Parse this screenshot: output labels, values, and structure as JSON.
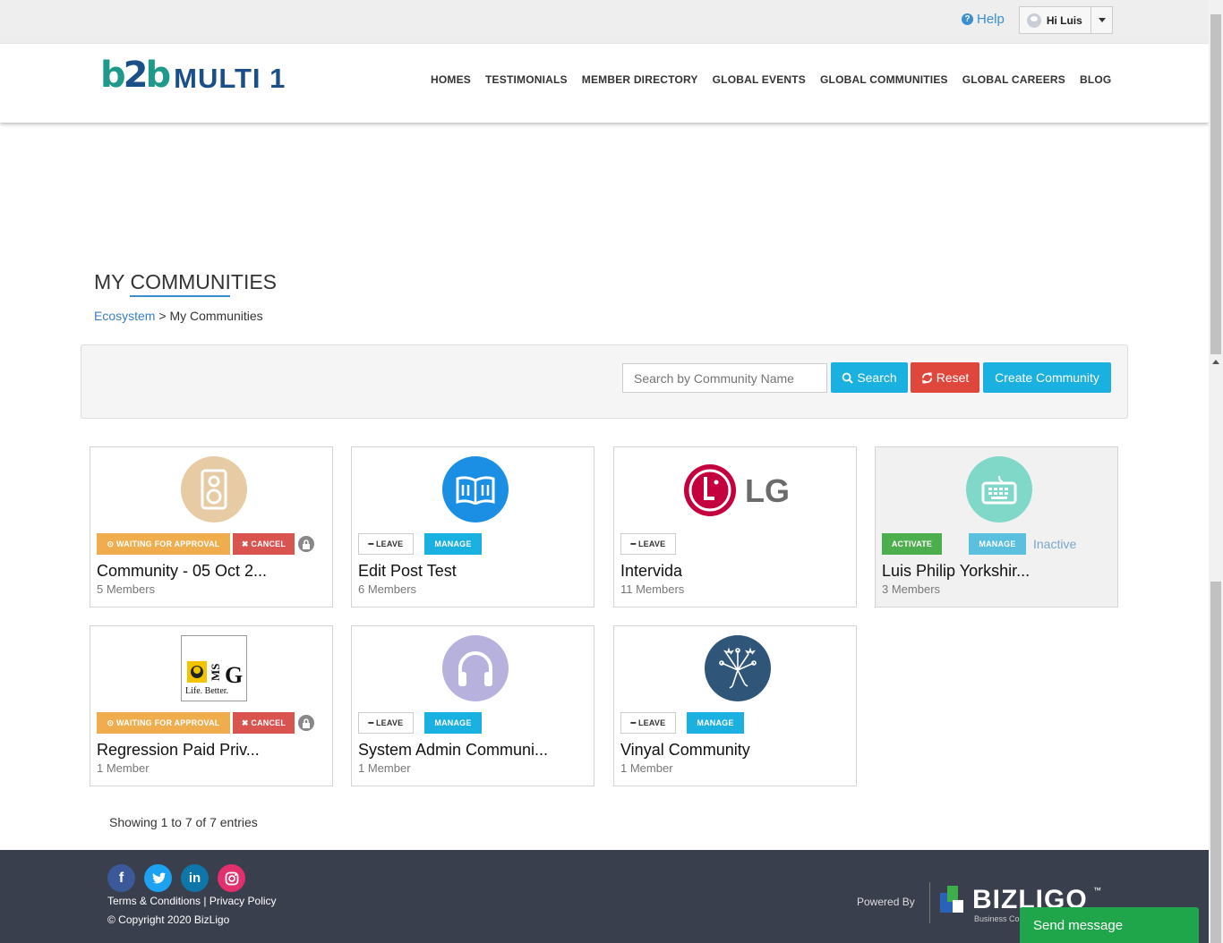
{
  "topbar": {
    "help_label": "Help",
    "user_label": "Hi Luis"
  },
  "header": {
    "logo_mark": "b2b",
    "logo_text": "MULTI 1",
    "nav": [
      "HOMES",
      "TESTIMONIALS",
      "MEMBER DIRECTORY",
      "GLOBAL EVENTS",
      "GLOBAL COMMUNITIES",
      "GLOBAL CAREERS",
      "BLOG"
    ]
  },
  "page": {
    "title": "MY COMMUNITIES",
    "breadcrumb_root": "Ecosystem",
    "breadcrumb_sep": " > ",
    "breadcrumb_current": "My Communities"
  },
  "search": {
    "placeholder": "Search by Community Name",
    "search_label": "Search",
    "reset_label": "Reset",
    "create_label": "Create Community"
  },
  "labels": {
    "waiting": "WAITING FOR APPROVAL",
    "cancel": "CANCEL",
    "leave": "LEAVE",
    "manage": "MANAGE",
    "activate": "ACTIVATE",
    "inactive": "Inactive"
  },
  "communities": [
    {
      "name": "Community - 05 Oct 2...",
      "members": "5 Members",
      "icon": "speaker-icon",
      "color": "#e6cba4"
    },
    {
      "name": "Edit Post Test",
      "members": "6 Members",
      "icon": "book-icon",
      "color": "#1a8fe3"
    },
    {
      "name": "Intervida",
      "members": "11 Members",
      "icon": "lg-logo",
      "color": "#c5003e"
    },
    {
      "name": "Luis Philip Yorkshir...",
      "members": "3 Members",
      "icon": "keyboard-icon",
      "color": "#7fd8c8"
    },
    {
      "name": "Regression Paid Priv...",
      "members": "1 Member",
      "icon": "mg-logo",
      "logo_text": "Life. Better.",
      "color": "#ffffff"
    },
    {
      "name": "System Admin Communi...",
      "members": "1 Member",
      "icon": "headphones-icon",
      "color": "#b7b1dd"
    },
    {
      "name": "Vinyal Community",
      "members": "1 Member",
      "icon": "fireworks-icon",
      "color": "#2f5679"
    }
  ],
  "pagination": {
    "summary": "Showing 1 to 7 of 7 entries"
  },
  "footer": {
    "terms": "Terms & Conditions",
    "sep": " | ",
    "privacy": "Privacy Policy",
    "copyright": "© Copyright 2020 BizLigo",
    "powered": "Powered By",
    "brand": "BIZLIGO",
    "brand_sub": "Business Co",
    "tm": "™"
  },
  "chat": {
    "label": "Send message"
  }
}
